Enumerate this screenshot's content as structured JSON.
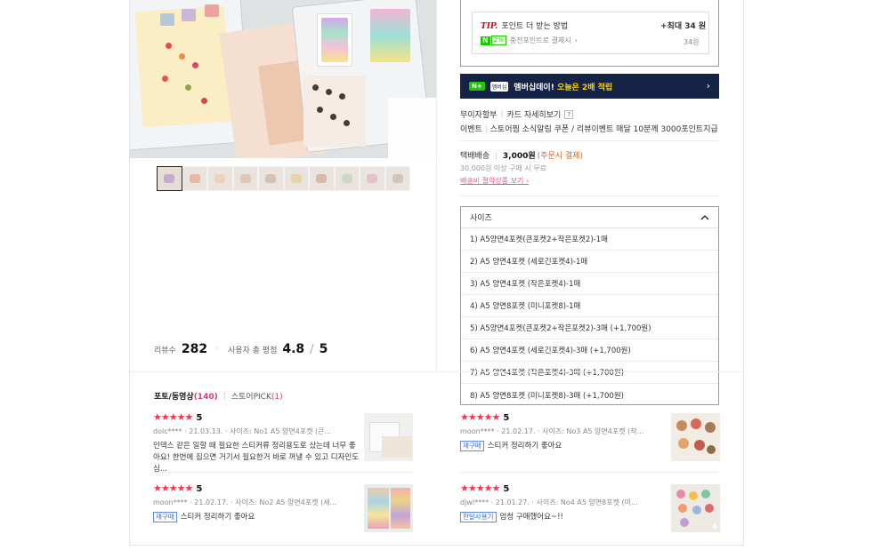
{
  "product": {
    "thumb_count": 10
  },
  "rating": {
    "review_label": "리뷰수",
    "review_count": "282",
    "score_label": "사용자 총 평점",
    "score": "4.8",
    "score_sep": "/",
    "score_max": "5"
  },
  "tip": {
    "brand": "TIP.",
    "title": "포인트 더 받는 방법",
    "max_label": "+최대 34 원",
    "npay": "N",
    "npct": "2%",
    "desc": "충전포인트로 결제시",
    "points": "34원"
  },
  "banner": {
    "badge1": "N+",
    "badge2": "멤버십",
    "text_a": "멤버십데이!",
    "text_b": "오늘은 2배 적립"
  },
  "benefits": {
    "installment": "무이자할부",
    "card": "카드 자세히보기",
    "qmark": "?",
    "event": "이벤트",
    "event_desc": "스토어찜 소식알림 쿠폰 / 리뷰이벤트 매달 10분께 3000포인트지급"
  },
  "shipping": {
    "type": "택배배송",
    "fee": "3,000원",
    "pay": "(주문시 결제)",
    "free": "30,000원 이상 구매 시 무료",
    "link": "배송비 절약상품 보기"
  },
  "options": {
    "label": "사이즈",
    "items": [
      "1) A5양면4포켓(큰포켓2+작은포켓2)-1매",
      "2) A5 양면4포켓 (세로긴포켓4)-1매",
      "3) A5 양면4포켓 (작은포켓4)-1매",
      "4) A5 양면8포켓 (미니포켓8)-1매",
      "5) A5양면4포켓(큰포켓2+작은포켓2)-3매 (+1,700원)",
      "6) A5 양면4포켓 (세로긴포켓4)-3매 (+1,700원)",
      "7) A5 양면4포켓 (작은포켓4)-3매 (+1,700원)",
      "8) A5 양면8포켓 (미니포켓8)-3매 (+1,700원)"
    ]
  },
  "reviews": {
    "tab_photo": "포토/동영상",
    "tab_photo_count": "(140)",
    "tab_store": "스토어PICK",
    "tab_store_count": "(1)",
    "items": [
      {
        "stars": "★★★★★",
        "score": "5",
        "user": "dolc****",
        "date": "21.03.13.",
        "option": "사이즈: No1 A5 양면4포켓 (큰...",
        "badge": "",
        "text": "인덱스 같은 일할 때 필요한 스티커류 정리용도로 샀는데 너무 좋아요! 한번에 집으면 거기서 필요한거 바로 꺼낼 수 있고 디자인도 심..."
      },
      {
        "stars": "★★★★★",
        "score": "5",
        "user": "moon****",
        "date": "21.02.17.",
        "option": "사이즈: No3 A5 양면4포켓 (작...",
        "badge": "재구매",
        "text": "스티커 정리하기 좋아요"
      },
      {
        "stars": "★★★★★",
        "score": "5",
        "user": "moon****",
        "date": "21.02.17.",
        "option": "사이즈: No2 A5 양면4포켓 (세...",
        "badge": "재구매",
        "text": "스티커 정리하기 좋아요"
      },
      {
        "stars": "★★★★★",
        "score": "5",
        "user": "djwl****",
        "date": "21.01.27.",
        "option": "사이즈: No4 A5 양면8포켓 (미...",
        "badge": "한달사용기",
        "text": "엄청 구매했어요~!!",
        "img_count": "6"
      }
    ]
  },
  "colors": {
    "star": "#f1384f",
    "banner_bg": "#152446",
    "naver_green": "#1ec800",
    "pink_link": "#ea5a8c"
  }
}
